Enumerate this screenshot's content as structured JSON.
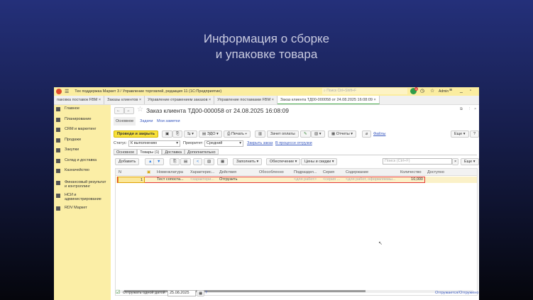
{
  "slide": {
    "title_line1": "Информация о сборке",
    "title_line2": "и упаковке товара"
  },
  "topbar": {
    "app_title": "Тех поддержка Маркет 3 / Управление торговлей, редакция 11  (1С:Предприятие)",
    "search_placeholder": "Поиск Ctrl+Shift+F",
    "notif_count": "8",
    "user": "Admin"
  },
  "tabs": [
    {
      "label": "паковка поставок FBM"
    },
    {
      "label": "Заказы клиентов"
    },
    {
      "label": "Управление отражением заказов"
    },
    {
      "label": "Управление поставками FBM"
    },
    {
      "label": "Заказ клиента ТД00-000058 от 24.08.2025 16:08:09"
    }
  ],
  "sidebar": {
    "items": [
      {
        "label": "Главное"
      },
      {
        "label": "Планирование"
      },
      {
        "label": "CRM и маркетинг"
      },
      {
        "label": "Продажи"
      },
      {
        "label": "Закупки"
      },
      {
        "label": "Склад и доставка"
      },
      {
        "label": "Казначейство"
      },
      {
        "label": "Финансовый результат и контроллинг"
      },
      {
        "label": "НСИ и администрирование"
      },
      {
        "label": "RDV Маркет"
      }
    ]
  },
  "doc": {
    "title": "Заказ клиента ТД00-000058 от 24.08.2025 16:08:09",
    "subtabs": [
      "Основное",
      "Задачи",
      "Мои заметки"
    ],
    "toolbar": {
      "post_close": "Проведи и закрыть",
      "edo": "ЭДО",
      "print": "Печать",
      "payment": "Зачет оплаты",
      "reports": "Отчеты",
      "files": "Файлы",
      "more": "Еще",
      "help": "?"
    },
    "status_label": "Статус:",
    "status_value": "К выполнению",
    "priority_label": "Приоритет:",
    "priority_value": "Средний",
    "close_order": "Закрыть заказ",
    "in_shipping": "В процессе отгрузки",
    "sections": [
      "Основное",
      "Товары (1)",
      "Доставка",
      "Дополнительно"
    ],
    "goods_toolbar": {
      "add": "Добавить",
      "fill": "Заполнить",
      "supply": "Обеспечение",
      "prices": "Цены и скидки",
      "search_placeholder": "Поиск (Ctrl+F)",
      "more": "Еще"
    },
    "columns": [
      "N",
      "Номенклатура",
      "Характерис...",
      "Действия",
      "Обособленно",
      "Подраздел...",
      "Серия",
      "Содержание",
      "Количество",
      "Доступно"
    ],
    "rows": [
      {
        "n": "1",
        "item": "Тест сопоста...",
        "char": "<характери...",
        "action": "Отгрузить",
        "separate": "",
        "dept": "<для работ>",
        "series": "<серия ...",
        "content": "<для работ, оформляемы...",
        "qty": "10,000",
        "avail": ""
      }
    ],
    "footer": {
      "ship_one_date": "Отгружать одной датой",
      "date": "25.08.2025",
      "help": "?",
      "status_link": "Отгружается/Отгружено"
    }
  }
}
